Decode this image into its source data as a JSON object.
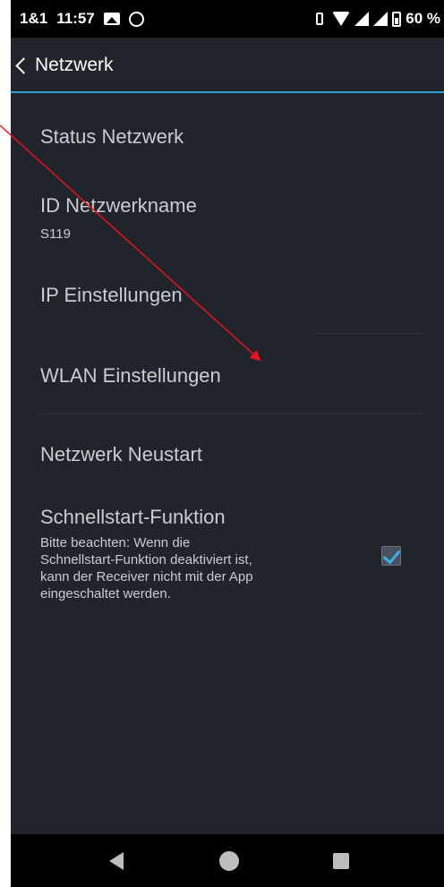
{
  "status_bar": {
    "carrier": "1&1",
    "time": "11:57",
    "battery": "60 %"
  },
  "app_bar": {
    "title": "Netzwerk"
  },
  "settings": {
    "items": [
      {
        "title": "Status Netzwerk"
      },
      {
        "title": "ID Netzwerkname",
        "subtitle": "S119"
      },
      {
        "title": "IP Einstellungen"
      },
      {
        "title": "WLAN Einstellungen"
      },
      {
        "title": "Netzwerk Neustart"
      },
      {
        "title": "Schnellstart-Funktion",
        "description_lines": [
          "Bitte beachten: Wenn die",
          "Schnellstart-Funktion deaktiviert ist,",
          "kann der Receiver nicht mit der App",
          "eingeschaltet werden."
        ],
        "checked": true
      }
    ]
  },
  "colors": {
    "background": "#21252b",
    "accent": "#2ea3d6",
    "text": "#c9ccd1",
    "annotation_arrow": "#e8131b"
  },
  "icons": {
    "status": [
      "gallery-icon",
      "chat-icon",
      "vibrate-icon",
      "wifi-icon",
      "signal-icon",
      "battery-icon"
    ],
    "nav": [
      "nav-back-icon",
      "nav-home-icon",
      "nav-recents-icon"
    ]
  }
}
